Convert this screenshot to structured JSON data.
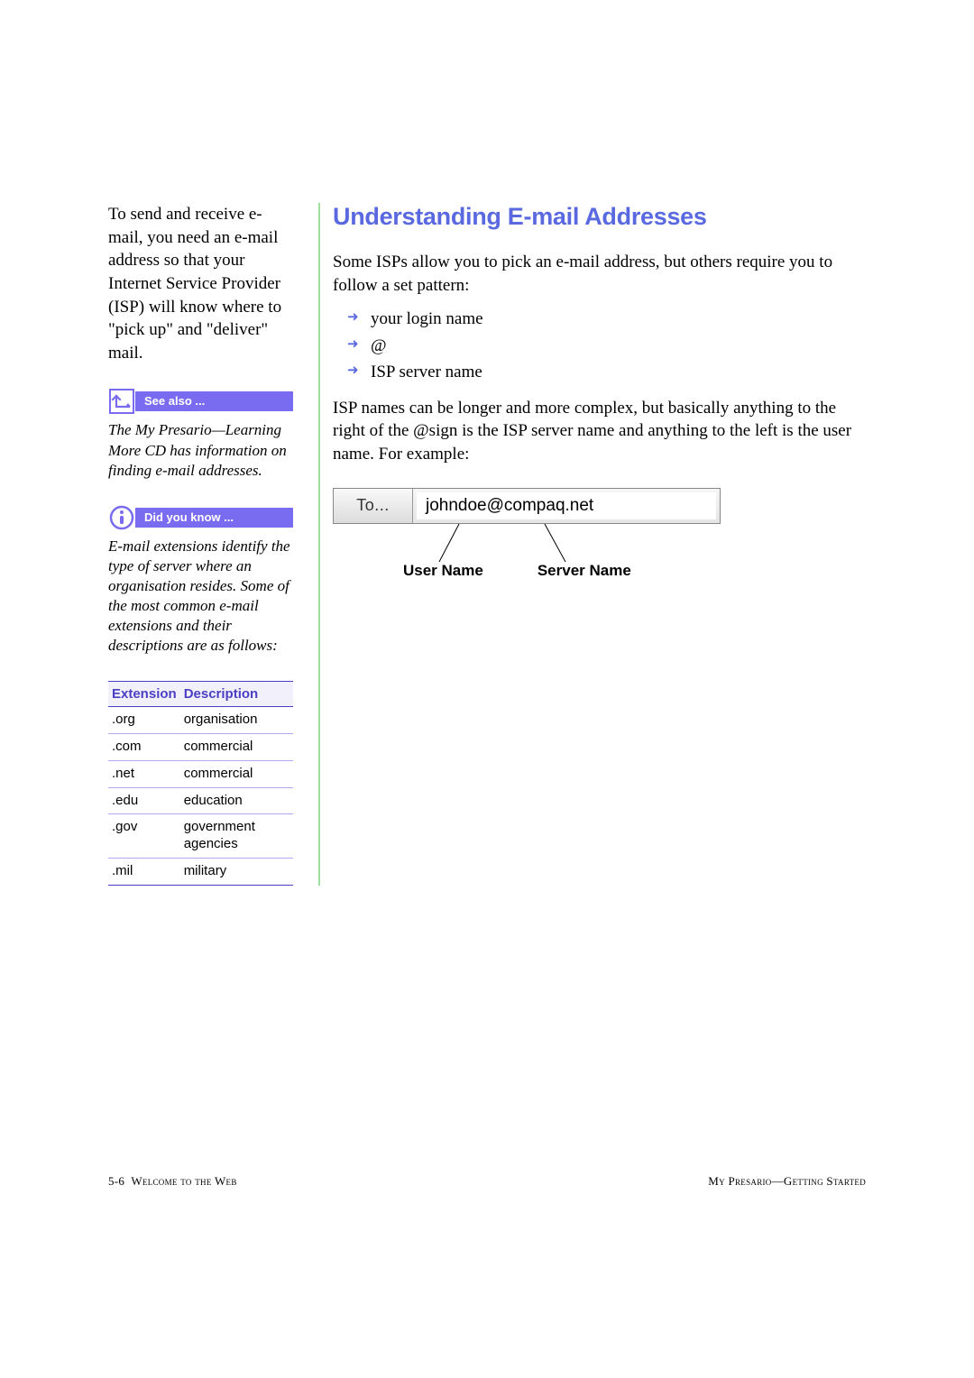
{
  "sidebar": {
    "intro": "To send and receive e-mail, you need an e-mail address so that your Internet Service Provider (ISP) will know where to \"pick up\" and \"deliver\" mail.",
    "see_also": {
      "label": "See also ...",
      "body": "The My Presario—Learning More CD has information on finding e-mail addresses."
    },
    "did_you_know": {
      "label": "Did you know ...",
      "body": "E-mail extensions identify the type of server where an organisation resides. Some of the most common e-mail extensions and their descriptions are as follows:"
    },
    "table": {
      "headers": [
        "Extension",
        "Description"
      ],
      "rows": [
        {
          "ext": ".org",
          "desc": "organisation"
        },
        {
          "ext": ".com",
          "desc": "commercial"
        },
        {
          "ext": ".net",
          "desc": "commercial"
        },
        {
          "ext": ".edu",
          "desc": "education"
        },
        {
          "ext": ".gov",
          "desc": "government agencies"
        },
        {
          "ext": ".mil",
          "desc": "military"
        }
      ]
    }
  },
  "main": {
    "heading": "Understanding E-mail Addresses",
    "p1": "Some ISPs allow you to pick an e-mail address, but others require you to follow a set pattern:",
    "bullets": [
      "your login name",
      "@",
      "ISP server name"
    ],
    "p2": "ISP names can be longer and more complex, but basically anything to the right of the @sign is the ISP server name and anything to the left is the user name. For example:",
    "diagram": {
      "to_label": "To...",
      "address": "johndoe@compaq.net",
      "user_label": "User Name",
      "server_label": "Server Name"
    }
  },
  "footer": {
    "page": "5-6",
    "left": "Welcome to the Web",
    "right": "My Presario—Getting Started"
  }
}
